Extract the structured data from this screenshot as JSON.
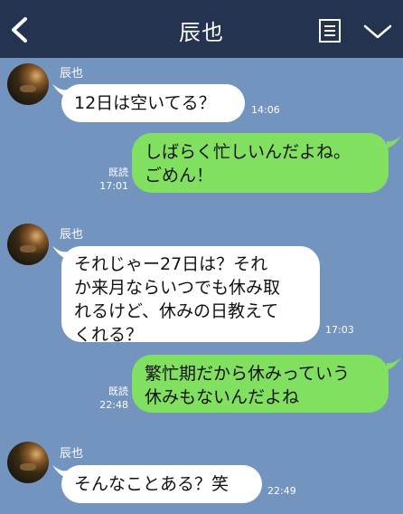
{
  "header": {
    "title": "辰也"
  },
  "messages": [
    {
      "sender": "辰也",
      "text": "12日は空いてる？",
      "time": "14:06"
    },
    {
      "lines": [
        "しばらく忙しいんだよね。",
        "ごめん！"
      ],
      "read": "既読",
      "time": "17:01"
    },
    {
      "sender": "辰也",
      "lines": [
        "それじゃー27日は？それ",
        "か来月ならいつでも休み取",
        "れるけど、休みの日教えて",
        "くれる？"
      ],
      "time": "17:03"
    },
    {
      "lines": [
        "繁忙期だから休みっていう",
        "休みもないんだよね"
      ],
      "read": "既読",
      "time": "22:48"
    },
    {
      "sender": "辰也",
      "text": "そんなことある？笑",
      "time": "22:49"
    }
  ],
  "colors": {
    "background": "#7494c0",
    "header": "#243350",
    "incoming": "#ffffff",
    "outgoing": "#82e061"
  }
}
